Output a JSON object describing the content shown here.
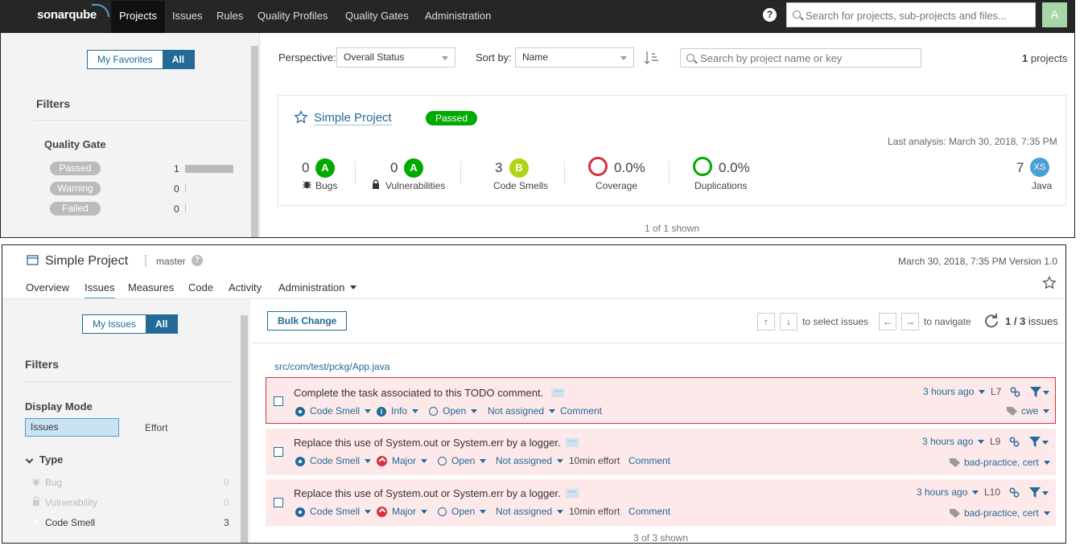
{
  "nav": {
    "logo": "sonarqube",
    "items": [
      "Projects",
      "Issues",
      "Rules",
      "Quality Profiles",
      "Quality Gates",
      "Administration"
    ],
    "search_placeholder": "Search for projects, sub-projects and files...",
    "avatar": "A",
    "help": "?"
  },
  "projects_sidebar": {
    "toggle": [
      "My Favorites",
      "All"
    ],
    "filters_title": "Filters",
    "quality_gate_title": "Quality Gate",
    "gates": [
      {
        "label": "Passed",
        "count": "1",
        "fraction": 1.0
      },
      {
        "label": "Warning",
        "count": "0",
        "fraction": 0
      },
      {
        "label": "Failed",
        "count": "0",
        "fraction": 0
      }
    ]
  },
  "projects_toolbar": {
    "perspective_label": "Perspective:",
    "perspective_value": "Overall Status",
    "sort_label": "Sort by:",
    "sort_value": "Name",
    "search_placeholder": "Search by project name or key",
    "count_number": "1",
    "count_text": "projects"
  },
  "project_card": {
    "name": "Simple Project",
    "status": "Passed",
    "last_analysis": "Last analysis: March 30, 2018, 7:35 PM",
    "measures": [
      {
        "value": "0",
        "rating": "A",
        "label": "Bugs"
      },
      {
        "value": "0",
        "rating": "A",
        "label": "Vulnerabilities"
      },
      {
        "value": "3",
        "rating": "B",
        "label": "Code Smells"
      },
      {
        "value": "0.0%",
        "label": "Coverage"
      },
      {
        "value": "0.0%",
        "label": "Duplications"
      }
    ],
    "size_value": "7",
    "size_rating": "XS",
    "language": "Java",
    "shown": "1 of 1 shown"
  },
  "project_header": {
    "title": "Simple Project",
    "branch": "master",
    "date": "March 30, 2018, 7:35 PM",
    "version": "Version 1.0",
    "tabs": [
      "Overview",
      "Issues",
      "Measures",
      "Code",
      "Activity",
      "Administration"
    ]
  },
  "issues_sidebar": {
    "toggle": [
      "My Issues",
      "All"
    ],
    "filters_title": "Filters",
    "display_mode_title": "Display Mode",
    "display_modes": [
      "Issues",
      "Effort"
    ],
    "type_title": "Type",
    "types": [
      {
        "label": "Bug",
        "count": "0"
      },
      {
        "label": "Vulnerability",
        "count": "0"
      },
      {
        "label": "Code Smell",
        "count": "3"
      }
    ]
  },
  "issues_toolbar": {
    "bulk_change": "Bulk Change",
    "select_hint": "to select issues",
    "navigate_hint": "to navigate",
    "count": "1 / 3",
    "count_label": "issues",
    "up": "↑",
    "down": "↓",
    "left": "←",
    "right": "→"
  },
  "file_path": "src/com/test/pckg/App.java",
  "issues": [
    {
      "message": "Complete the task associated to this TODO comment.",
      "type": "Code Smell",
      "severity": "Info",
      "status": "Open",
      "assignee": "Not assigned",
      "effort": "",
      "comment": "Comment",
      "time": "3 hours ago",
      "line": "L7",
      "tags": "cwe"
    },
    {
      "message": "Replace this use of System.out or System.err by a logger.",
      "type": "Code Smell",
      "severity": "Major",
      "status": "Open",
      "assignee": "Not assigned",
      "effort": "10min effort",
      "comment": "Comment",
      "time": "3 hours ago",
      "line": "L9",
      "tags": "bad-practice, cert"
    },
    {
      "message": "Replace this use of System.out or System.err by a logger.",
      "type": "Code Smell",
      "severity": "Major",
      "status": "Open",
      "assignee": "Not assigned",
      "effort": "10min effort",
      "comment": "Comment",
      "time": "3 hours ago",
      "line": "L10",
      "tags": "bad-practice, cert"
    }
  ],
  "issues_shown": "3 of 3 shown",
  "colors": {
    "nav": "#262626",
    "accent": "#236a97",
    "passed": "#00aa00",
    "rating_a": "#00aa00",
    "rating_b": "#b0d513",
    "coverage": "#d4333f",
    "issue_bg": "#fde9ea"
  },
  "icons": [
    "search-icon",
    "help-icon",
    "star-icon",
    "bug-icon",
    "lock-icon",
    "code-smell-icon",
    "sort-icon",
    "branch-icon",
    "project-icon",
    "refresh-icon",
    "link-icon",
    "filter-icon",
    "tag-icon",
    "chevron-down-icon"
  ]
}
